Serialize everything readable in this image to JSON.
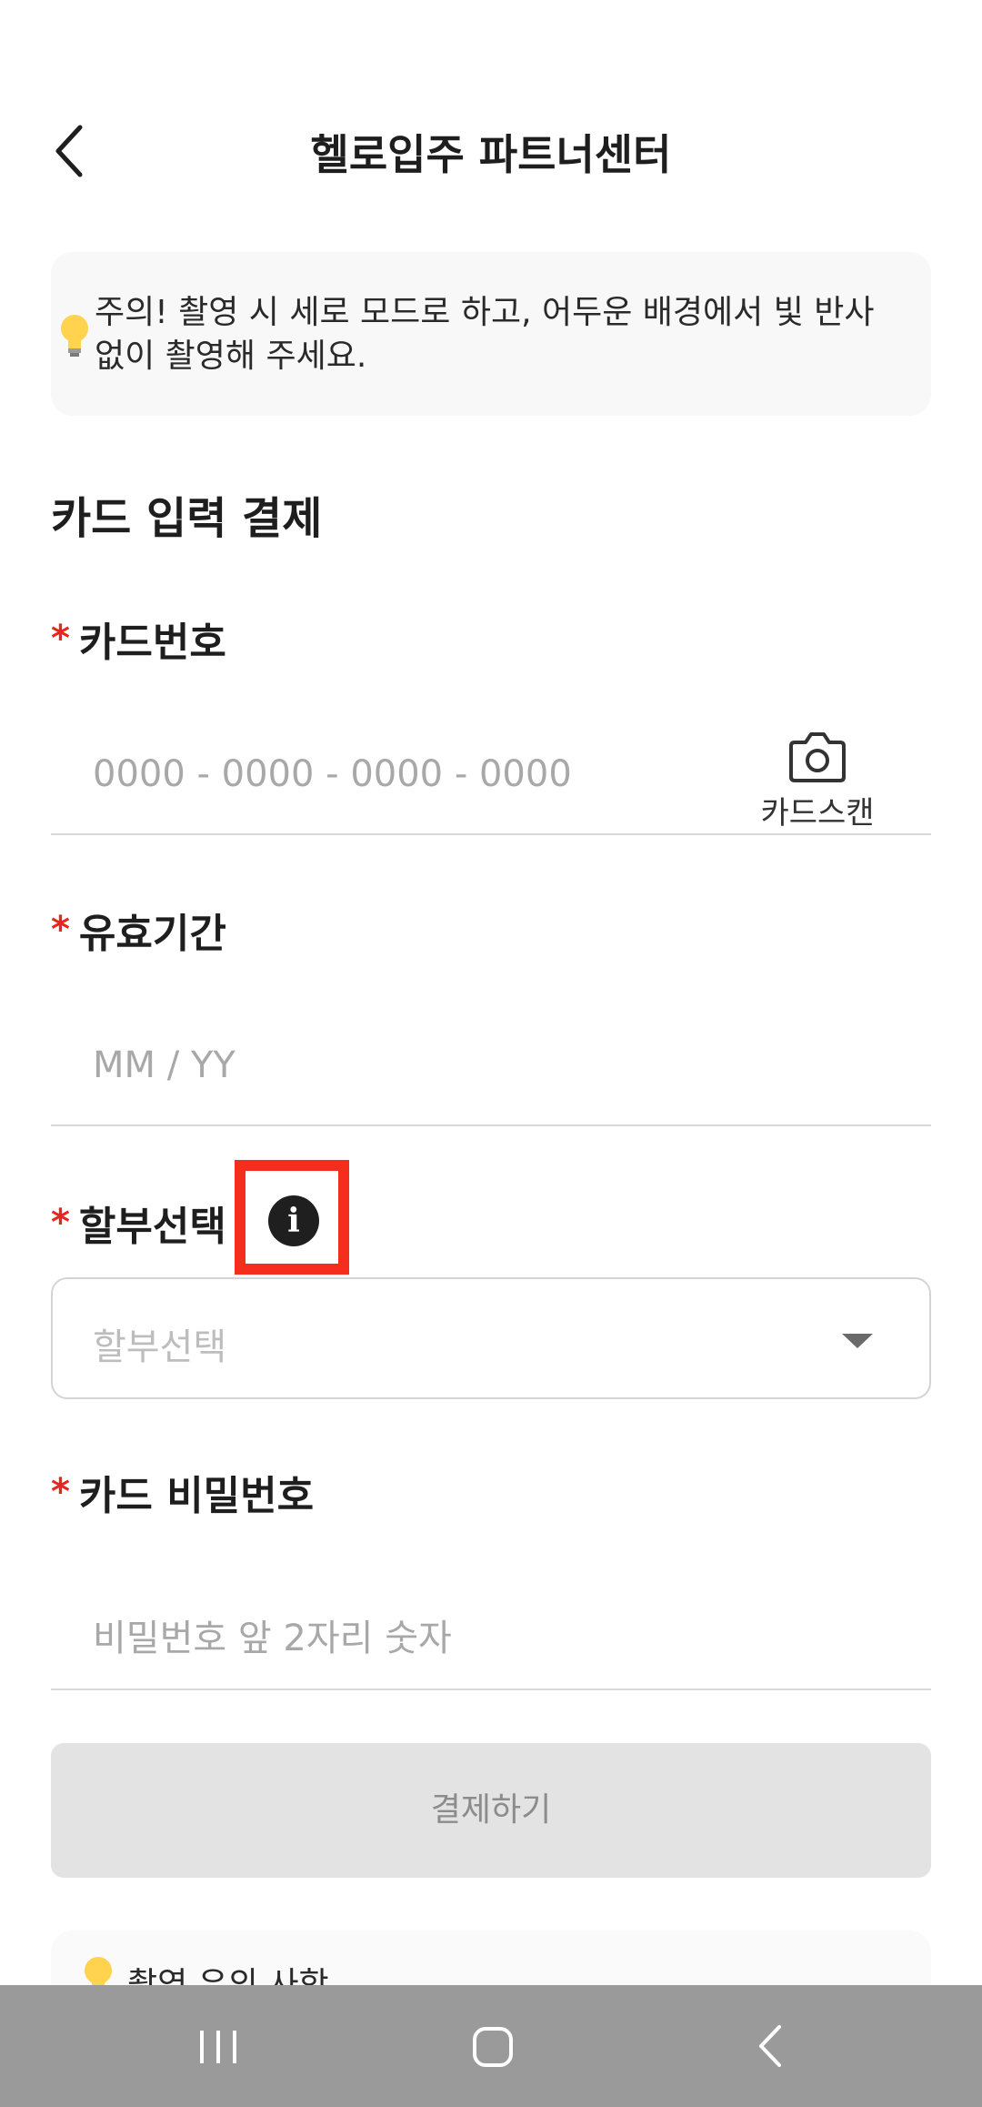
{
  "header": {
    "title": "헬로입주 파트너센터"
  },
  "notice": {
    "text": "주의! 촬영 시 세로 모드로 하고, 어두운 배경에서 빛 반사 없이 촬영해 주세요."
  },
  "section": {
    "title": "카드 입력 결제"
  },
  "required_mark": "*",
  "card_number": {
    "label": "카드번호",
    "placeholder": "0000 - 0000 - 0000 - 0000",
    "scan_label": "카드스캔"
  },
  "expiry": {
    "label": "유효기간",
    "placeholder": "MM / YY"
  },
  "installment": {
    "label": "할부선택",
    "info_icon": "i",
    "placeholder": "할부선택"
  },
  "card_password": {
    "label": "카드 비밀번호",
    "placeholder": "비밀번호 앞 2자리 숫자"
  },
  "pay_button": {
    "label": "결제하기"
  },
  "caution": {
    "text": "촬영 유의 사항"
  },
  "colors": {
    "required": "#e8261c",
    "highlight": "#f42d1c",
    "button_disabled": "#e3e3e3",
    "navbar": "#9a9a9a"
  },
  "icons": [
    "back-arrow-icon",
    "lightbulb-icon",
    "camera-icon",
    "info-icon",
    "dropdown-caret-icon",
    "recent-apps-icon",
    "home-icon",
    "nav-back-icon"
  ]
}
